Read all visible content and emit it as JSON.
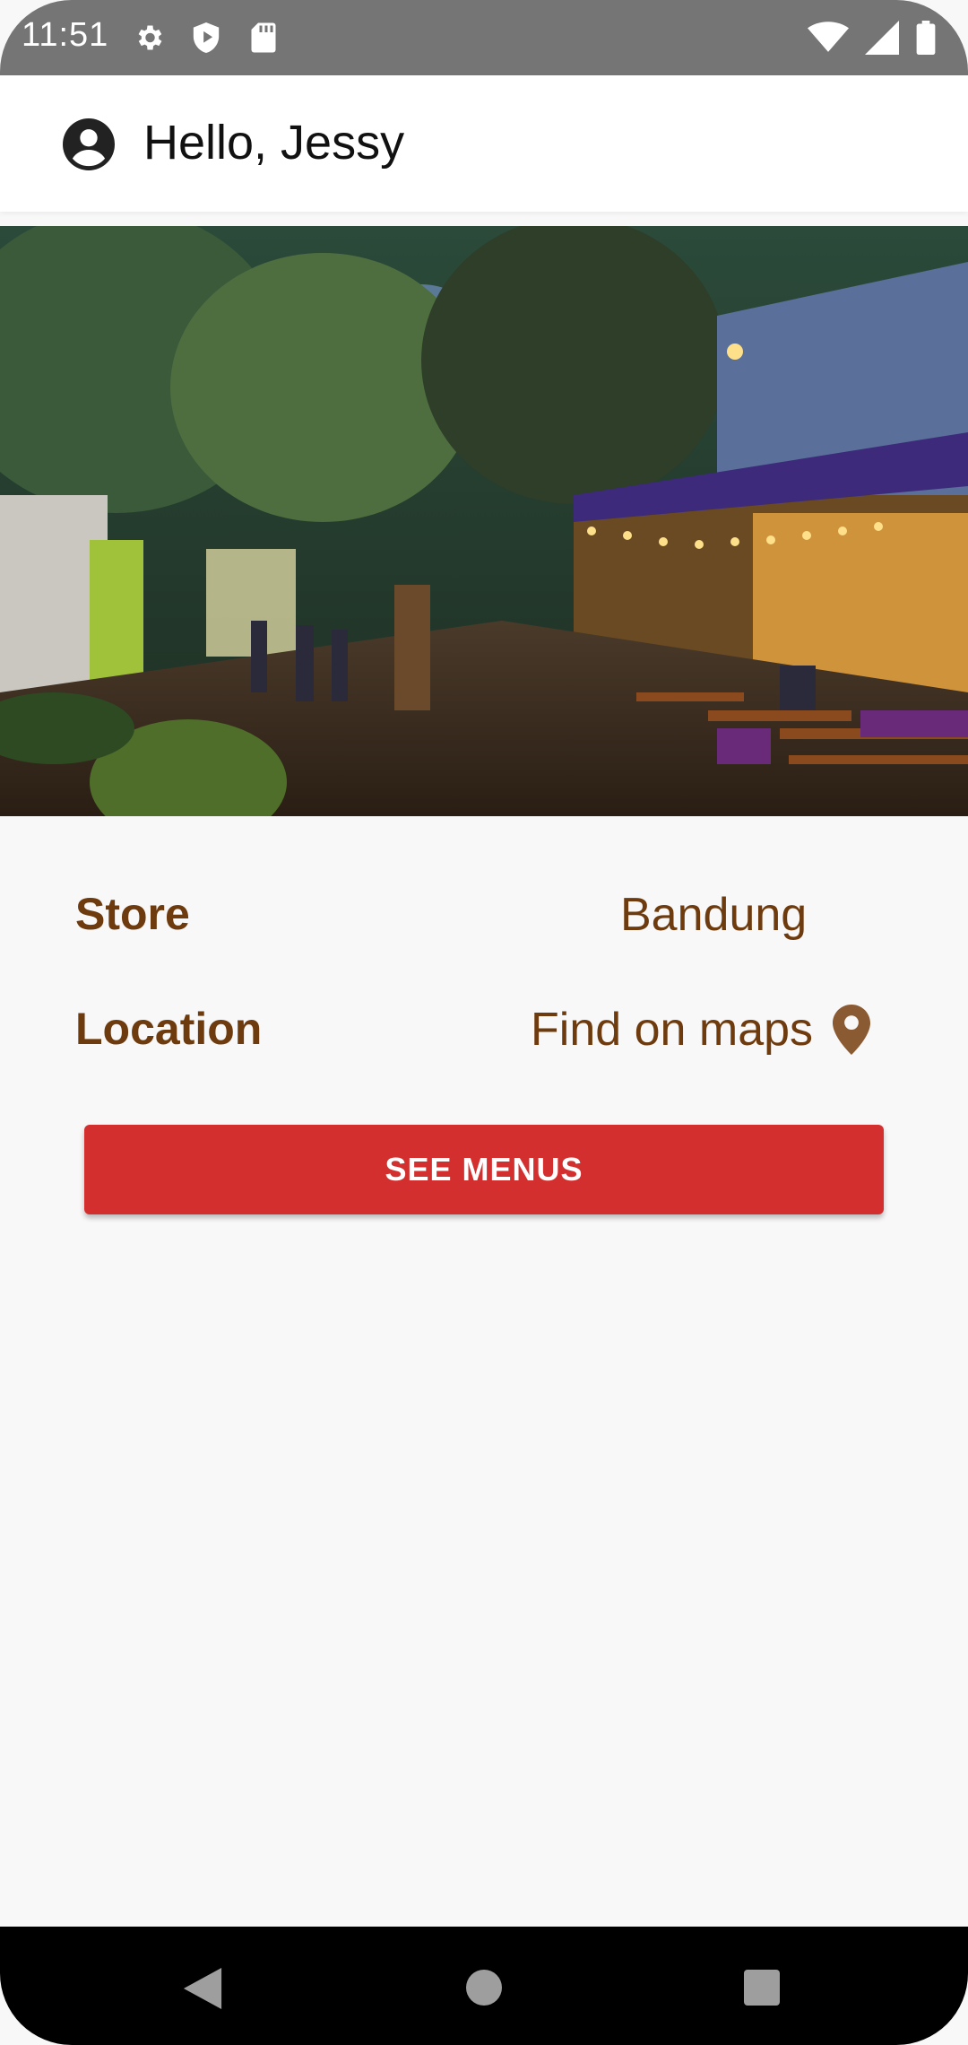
{
  "status_bar": {
    "time": "11:51",
    "left_icons": [
      "settings-icon",
      "play-protect-icon",
      "sd-card-icon"
    ],
    "right_icons": [
      "wifi-icon",
      "signal-icon",
      "battery-icon"
    ]
  },
  "app_bar": {
    "greeting": "Hello, Jessy",
    "avatar_icon": "account-circle-icon"
  },
  "hero": {
    "description_icon": "store-photo"
  },
  "store": {
    "label": "Store",
    "value": "Bandung"
  },
  "location": {
    "label": "Location",
    "value": "Find on maps",
    "icon": "map-pin-icon"
  },
  "actions": {
    "see_menus_label": "SEE MENUS"
  },
  "colors": {
    "accent": "#d32f2f",
    "brand_text": "#6d3b0e",
    "pin": "#8a5a32"
  },
  "nav_bar": {
    "icons": [
      "back-icon",
      "home-icon",
      "recents-icon"
    ]
  }
}
